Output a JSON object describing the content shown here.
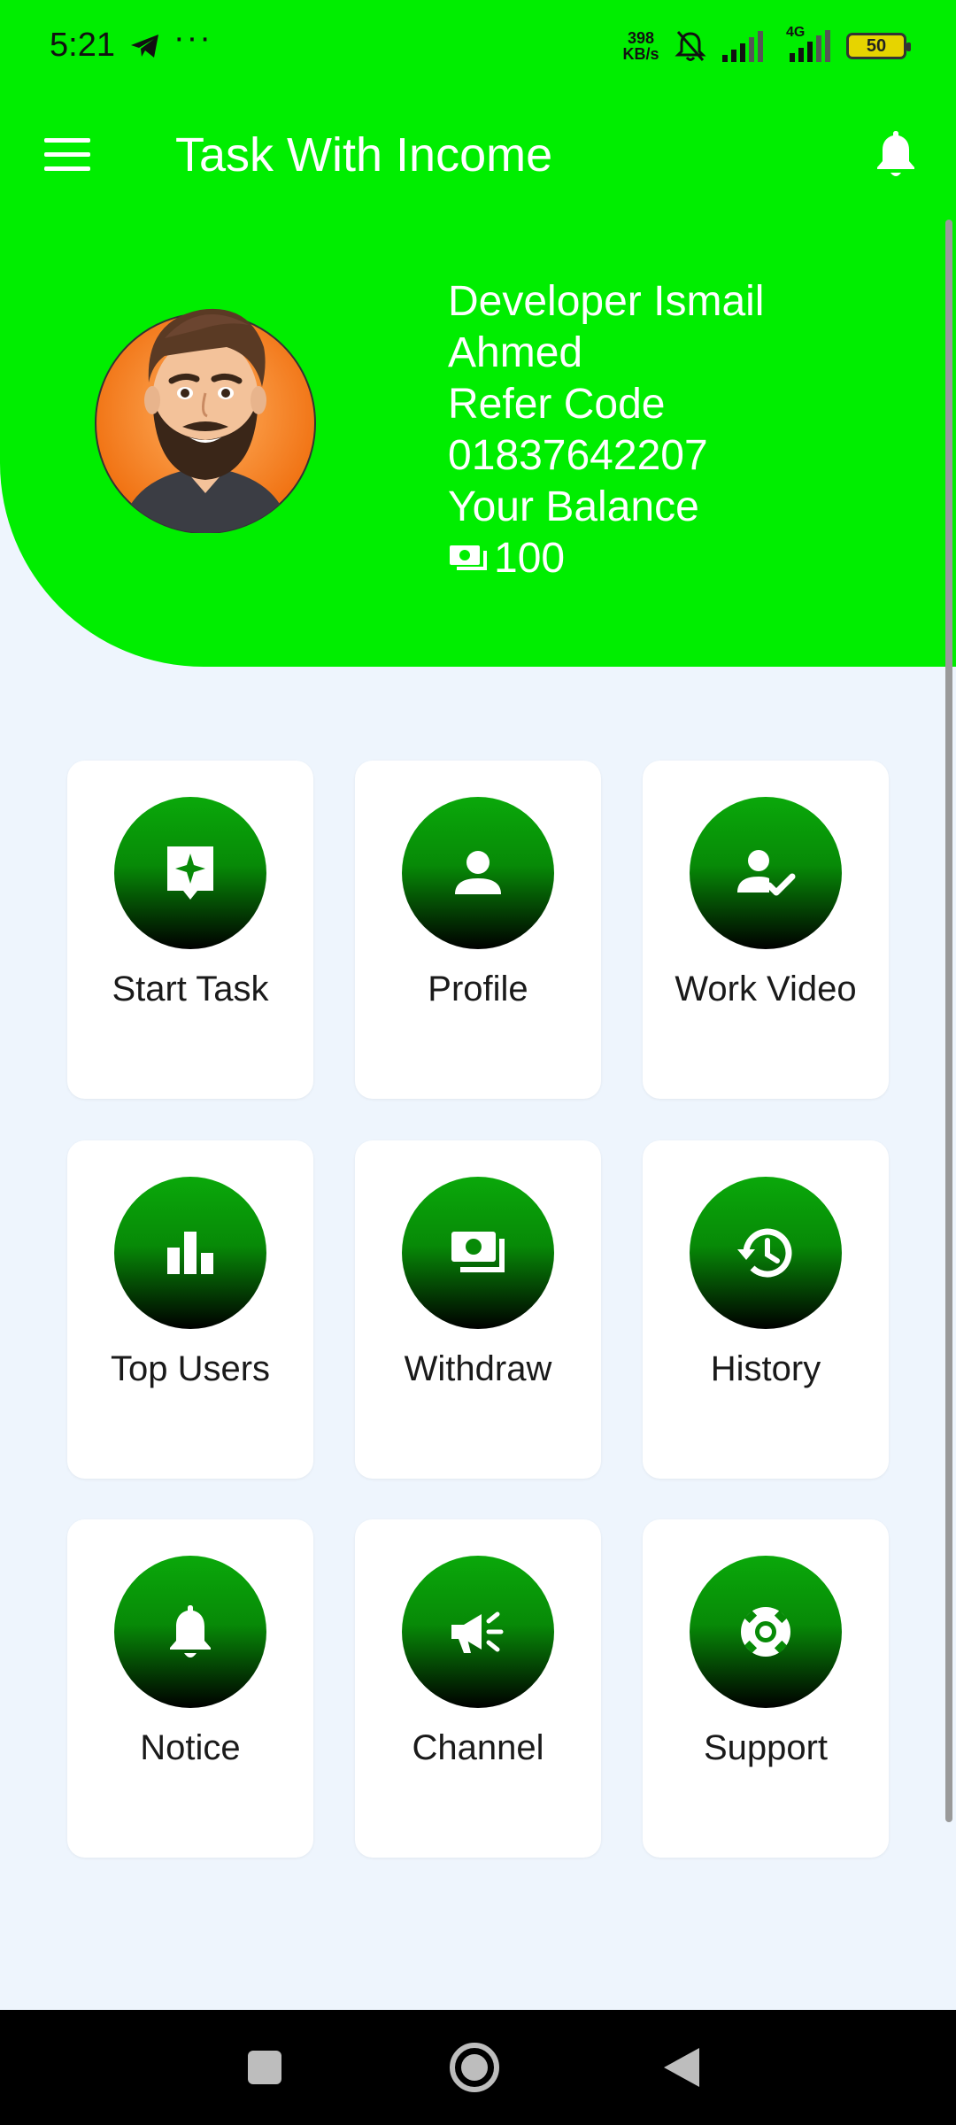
{
  "status_bar": {
    "time": "5:21",
    "dots": "···",
    "net_speed_value": "398",
    "net_speed_unit": "KB/s",
    "network_type": "4G",
    "battery": "50"
  },
  "app_bar": {
    "title": "Task With Income",
    "menu_icon": "menu-icon",
    "notifications_icon": "bell-icon"
  },
  "profile": {
    "name_line1": "Developer Ismail",
    "name_line2": "Ahmed",
    "refer_label": "Refer Code",
    "refer_code": "01837642207",
    "balance_label": "Your Balance",
    "balance": "100"
  },
  "menu": [
    {
      "label": "Start Task",
      "icon": "task-sparkle-icon"
    },
    {
      "label": "Profile",
      "icon": "person-icon"
    },
    {
      "label": "Work Video",
      "icon": "person-check-icon"
    },
    {
      "label": "Top Users",
      "icon": "bar-chart-icon"
    },
    {
      "label": "Withdraw",
      "icon": "cash-icon"
    },
    {
      "label": "History",
      "icon": "history-icon"
    },
    {
      "label": "Notice",
      "icon": "bell-icon"
    },
    {
      "label": "Channel",
      "icon": "megaphone-icon"
    },
    {
      "label": "Support",
      "icon": "lifebuoy-icon"
    }
  ],
  "colors": {
    "brand_green": "#00ee00",
    "tile_icon_gradient_top": "#0aa80a",
    "page_background": "#eef5fd"
  }
}
